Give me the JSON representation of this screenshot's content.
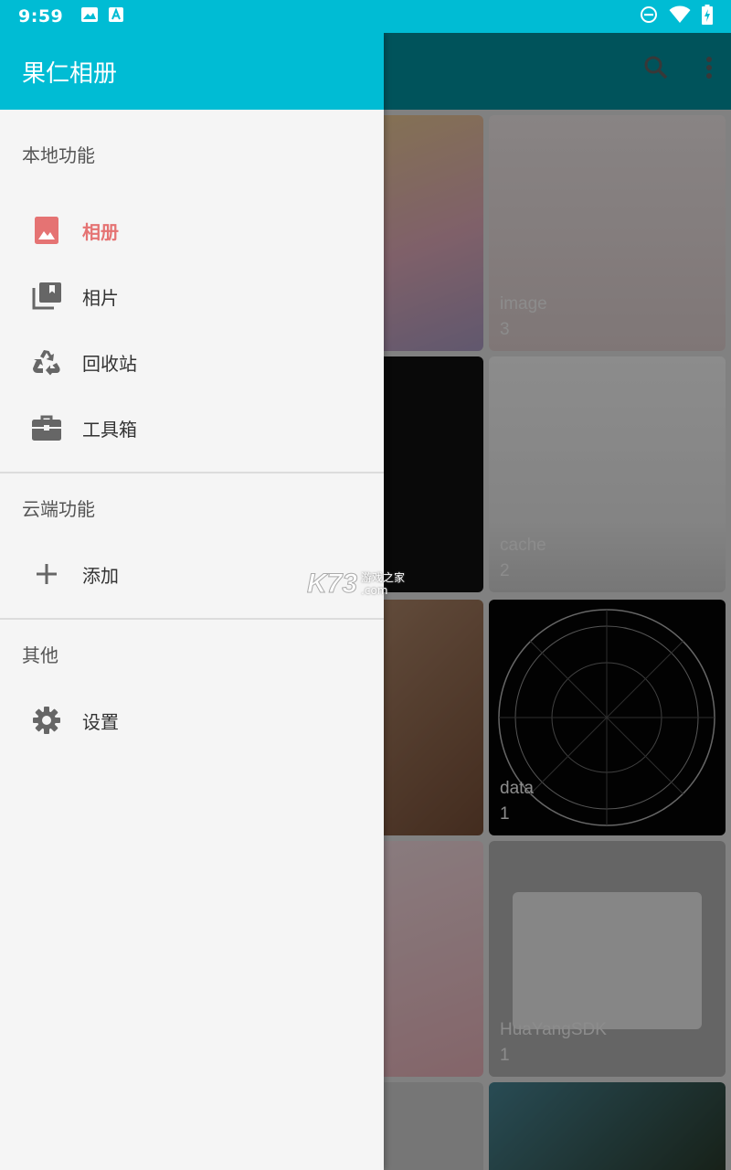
{
  "status_bar": {
    "time": "9:59",
    "left_icons": [
      "image-icon",
      "text-a-icon"
    ],
    "right_icons": [
      "do-not-disturb-icon",
      "wifi-icon",
      "battery-charging-icon"
    ]
  },
  "drawer": {
    "title": "果仁相册",
    "sections": [
      {
        "title": "本地功能",
        "items": [
          {
            "label": "相册",
            "icon": "photo-album-icon",
            "active": true
          },
          {
            "label": "相片",
            "icon": "photo-library-icon",
            "active": false
          },
          {
            "label": "回收站",
            "icon": "recycle-icon",
            "active": false
          },
          {
            "label": "工具箱",
            "icon": "toolbox-icon",
            "active": false
          }
        ]
      },
      {
        "title": "云端功能",
        "items": [
          {
            "label": "添加",
            "icon": "add-icon",
            "active": false
          }
        ]
      },
      {
        "title": "其他",
        "items": [
          {
            "label": "设置",
            "icon": "gear-icon",
            "active": false
          }
        ]
      }
    ]
  },
  "app_bar": {
    "icons": [
      "search-icon",
      "more-vert-icon"
    ]
  },
  "albums": [
    {
      "name": "",
      "count": ""
    },
    {
      "name": "image",
      "count": "3"
    },
    {
      "name": "",
      "count": ""
    },
    {
      "name": "cache",
      "count": "2"
    },
    {
      "name": "",
      "count": ""
    },
    {
      "name": "data",
      "count": "1"
    },
    {
      "name": "",
      "count": ""
    },
    {
      "name": "HuaYangSDK",
      "count": "1"
    }
  ],
  "watermark": {
    "logo": "K73",
    "line1": "游戏之家",
    "line2": ".com"
  },
  "colors": {
    "primary": "#00bcd4",
    "active_item": "#e57373",
    "icon_gray": "#666666"
  }
}
